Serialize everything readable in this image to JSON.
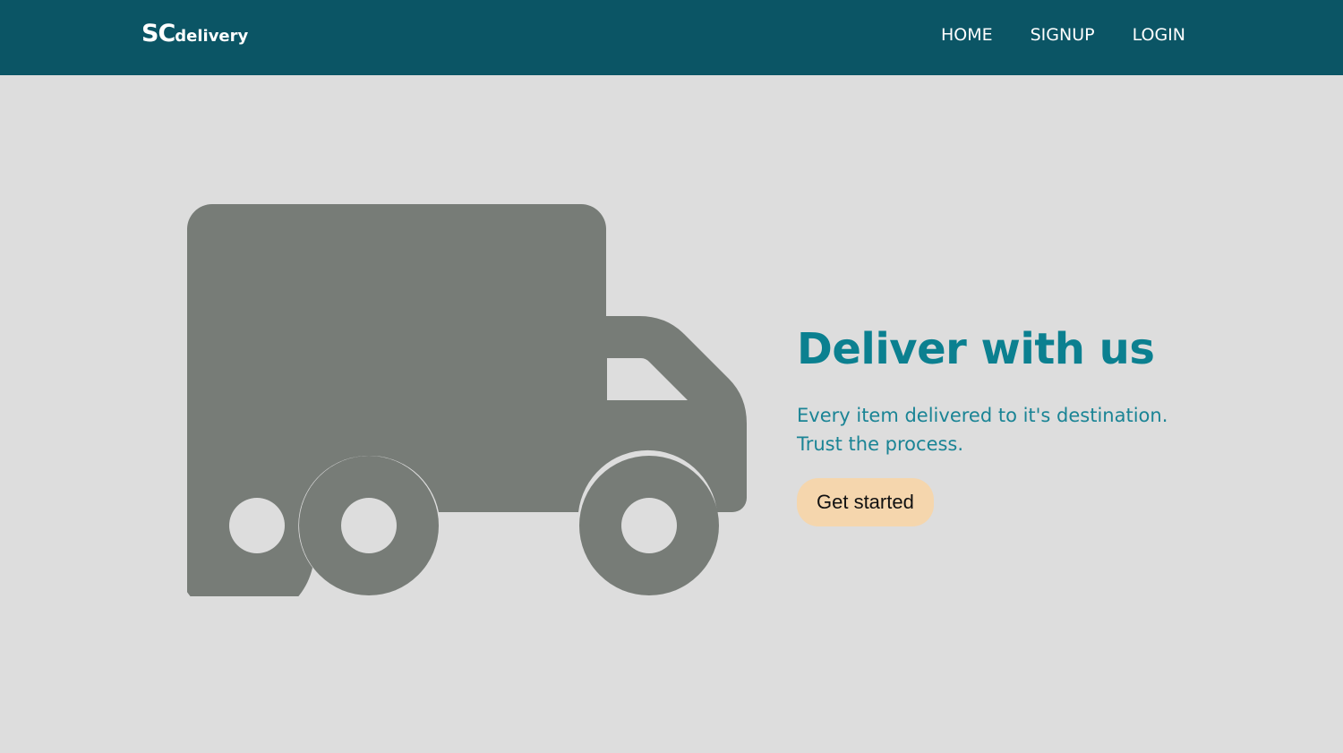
{
  "navbar": {
    "logo_big": "SC",
    "logo_small": "delivery",
    "links": [
      {
        "label": "HOME"
      },
      {
        "label": "SIGNUP"
      },
      {
        "label": "LOGIN"
      }
    ]
  },
  "hero": {
    "icon": "truck-icon",
    "title": "Deliver with us",
    "subtitle_line1": "Every item delivered to it's destination.",
    "subtitle_line2": "Trust the process.",
    "cta_label": "Get started"
  },
  "colors": {
    "navbar_bg": "#0b5565",
    "page_bg": "#dddddd",
    "accent": "#0b8090",
    "truck": "#777c77",
    "cta_bg": "#f5d6ad"
  }
}
